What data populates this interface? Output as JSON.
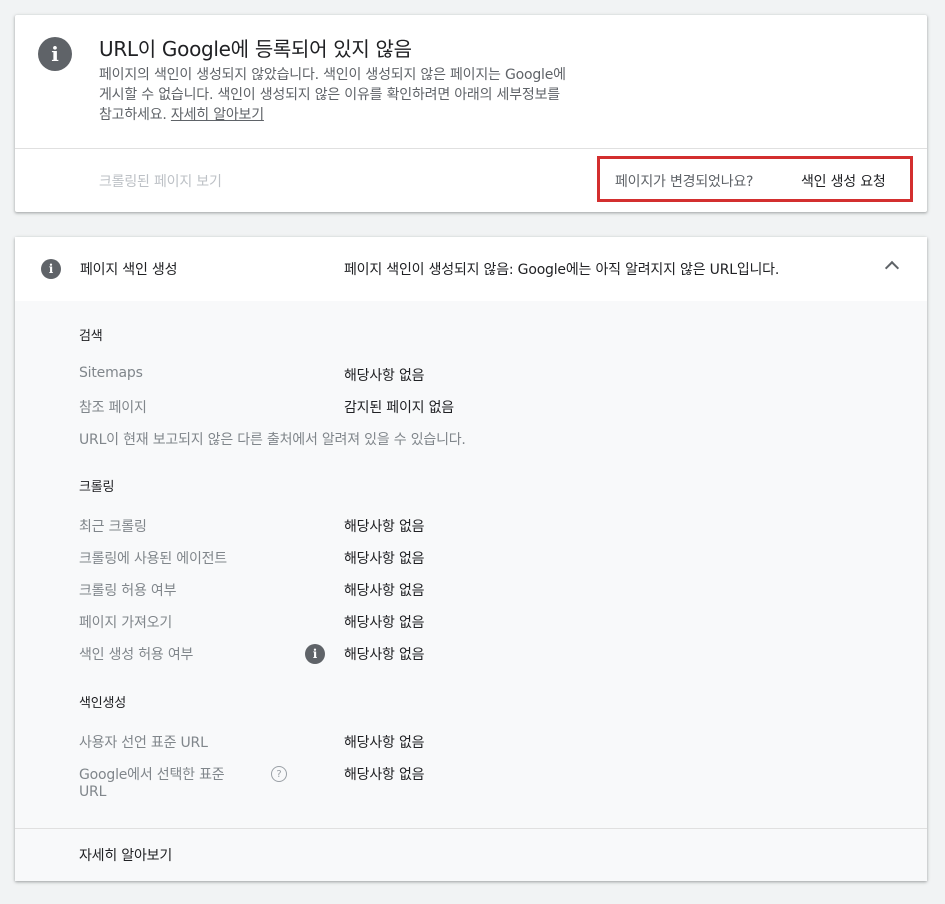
{
  "status_card": {
    "title": "URL이 Google에 등록되어 있지 않음",
    "desc_1": "페이지의 색인이 생성되지 않았습니다. 색인이 생성되지 않은 페이지는 Google에",
    "desc_2": "게시할 수 없습니다. 색인이 생성되지 않은 이유를 확인하려면 아래의 세부정보를",
    "desc_3_prefix": "참고하세요. ",
    "learn_more": "자세히 알아보기",
    "crawled_page_link": "크롤링된 페이지 보기",
    "page_changed_question": "페이지가 변경되었나요?",
    "request_indexing": "색인 생성 요청"
  },
  "detail_card": {
    "header_label": "페이지 색인 생성",
    "header_status": "페이지 색인이 생성되지 않음: Google에는 아직 알려지지 않은 URL입니다.",
    "sections": {
      "discovery": {
        "title": "검색",
        "sitemaps_label": "Sitemaps",
        "sitemaps_value": "해당사항 없음",
        "referring_label": "참조 페이지",
        "referring_value": "감지된 페이지 없음",
        "note": "URL이 현재 보고되지 않은 다른 출처에서 알려져 있을 수 있습니다."
      },
      "crawl": {
        "title": "크롤링",
        "last_crawl_label": "최근 크롤링",
        "last_crawl_value": "해당사항 없음",
        "crawled_as_label": "크롤링에 사용된 에이전트",
        "crawled_as_value": "해당사항 없음",
        "crawl_allowed_label": "크롤링 허용 여부",
        "crawl_allowed_value": "해당사항 없음",
        "page_fetch_label": "페이지 가져오기",
        "page_fetch_value": "해당사항 없음",
        "indexing_allowed_label": "색인 생성 허용 여부",
        "indexing_allowed_value": "해당사항 없음"
      },
      "indexing": {
        "title": "색인생성",
        "user_canonical_label": "사용자 선언 표준 URL",
        "user_canonical_value": "해당사항 없음",
        "google_canonical_label_1": "Google에서 선택한 표준",
        "google_canonical_label_2": "URL",
        "google_canonical_value": "해당사항 없음"
      }
    },
    "footer_learn_more": "자세히 알아보기"
  }
}
